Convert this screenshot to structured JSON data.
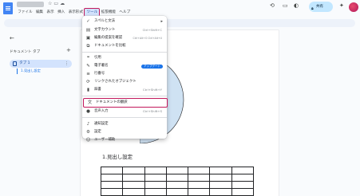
{
  "menubar": {
    "items": [
      "ファイル",
      "編集",
      "表示",
      "挿入",
      "表示形式",
      "ツール",
      "拡張機能",
      "ヘルプ"
    ],
    "active": "ツール"
  },
  "topbar": {
    "share_label": "共有"
  },
  "sidebar": {
    "outline_title": "ドキュメント タブ",
    "tab_label": "タブ 1",
    "heading_item": "1.見出し設定"
  },
  "tools_menu": {
    "items": [
      {
        "label": "スペルと文法",
        "shortcut": "",
        "submenu": true,
        "icon": "spellcheck-icon"
      },
      {
        "label": "文字カウント",
        "shortcut": "Ctrl+Shift+C",
        "icon": "word-count-icon"
      },
      {
        "label": "編集の提案を確認",
        "shortcut": "Ctrl+Alt+O Ctrl+Alt+U",
        "icon": "review-edits-icon"
      },
      {
        "label": "ドキュメントを比較",
        "shortcut": "",
        "icon": "compare-icon"
      },
      {
        "label": "引用",
        "shortcut": "",
        "icon": "citations-icon"
      },
      {
        "label": "電子署名",
        "shortcut": "",
        "badge": "アップデート",
        "icon": "esignature-icon"
      },
      {
        "label": "行番号",
        "shortcut": "",
        "icon": "line-numbers-icon"
      },
      {
        "label": "リンクされたオブジェクト",
        "shortcut": "",
        "icon": "linked-objects-icon"
      },
      {
        "label": "辞書",
        "shortcut": "Ctrl+Shift+Y",
        "icon": "dictionary-icon"
      },
      {
        "label": "ドキュメントの翻訳",
        "shortcut": "",
        "icon": "translate-icon"
      },
      {
        "label": "音声入力",
        "shortcut": "Ctrl+Shift+S",
        "icon": "voice-typing-icon"
      },
      {
        "label": "通知設定",
        "shortcut": "",
        "icon": "notification-icon"
      },
      {
        "label": "設定",
        "shortcut": "",
        "icon": "settings-icon"
      },
      {
        "label": "ユーザー補助",
        "shortcut": "",
        "icon": "accessibility-icon"
      }
    ],
    "highlighted": "ドキュメントの翻訳"
  },
  "document": {
    "heading": "1.見出し設定"
  },
  "colors": {
    "accent": "#1a73e8",
    "highlight_outline": "#c2185b",
    "pie_fill": "#cfe2f3"
  }
}
